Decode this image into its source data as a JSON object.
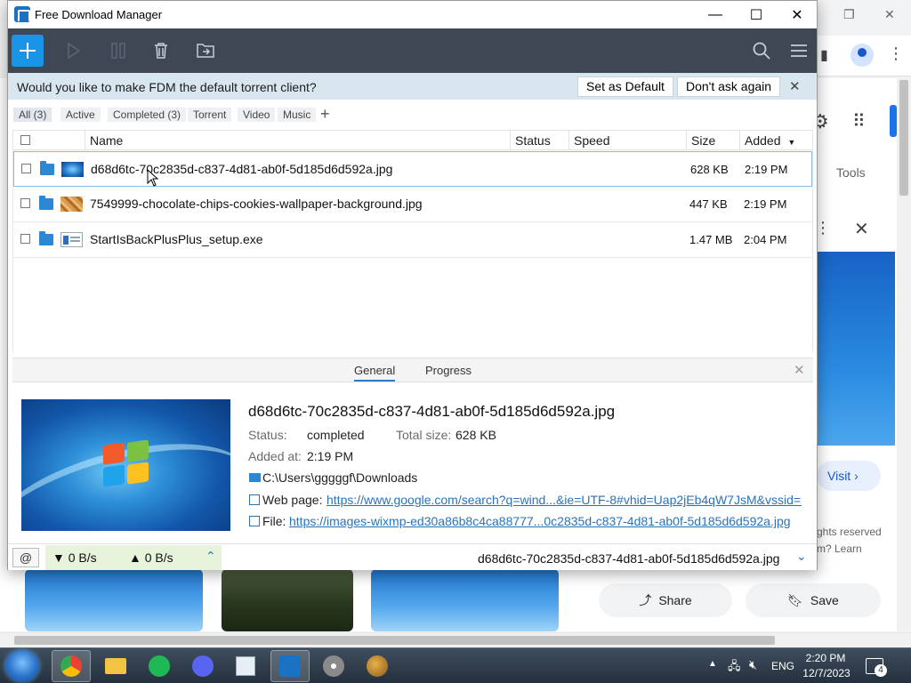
{
  "app": {
    "title": "Free Download Manager"
  },
  "window_controls": {
    "minimize": "—",
    "maximize": "☐",
    "close": "✕"
  },
  "notice": {
    "message": "Would you like to make FDM the default torrent client?",
    "set_default": "Set as Default",
    "dont_ask": "Don't ask again",
    "close": "✕"
  },
  "filters": [
    {
      "label": "All (3)"
    },
    {
      "label": "Active"
    },
    {
      "label": "Completed (3)"
    },
    {
      "label": "Torrent"
    },
    {
      "label": "Video"
    },
    {
      "label": "Music"
    }
  ],
  "filter_add": "+",
  "columns": {
    "name": "Name",
    "status": "Status",
    "speed": "Speed",
    "size": "Size",
    "added": "Added"
  },
  "downloads": [
    {
      "name": "d68d6tc-70c2835d-c837-4d81-ab0f-5d185d6d592a.jpg",
      "size": "628 KB",
      "added": "2:19 PM"
    },
    {
      "name": "7549999-chocolate-chips-cookies-wallpaper-background.jpg",
      "size": "447 KB",
      "added": "2:19 PM"
    },
    {
      "name": "StartIsBackPlusPlus_setup.exe",
      "size": "1.47 MB",
      "added": "2:04 PM"
    }
  ],
  "details": {
    "tabs": {
      "general": "General",
      "progress": "Progress"
    },
    "close": "✕",
    "file_name": "d68d6tc-70c2835d-c837-4d81-ab0f-5d185d6d592a.jpg",
    "status_label": "Status:",
    "status_value": "completed",
    "total_size_label": "Total size:",
    "total_size_value": "628 KB",
    "added_label": "Added at:",
    "added_value": "2:19 PM",
    "folder": "C:\\Users\\gggggf\\Downloads",
    "web_page_label": "Web page:",
    "web_page_url": "https://www.google.com/search?q=wind...&ie=UTF-8#vhid=Uap2jEb4qW7JsM&vssid=l",
    "file_label": "File:",
    "file_url": "https://images-wixmp-ed30a86b8c4ca88777...0c2835d-c837-4d81-ab0f-5d185d6d592a.jpg"
  },
  "statusbar": {
    "download_speed": "▼ 0 B/s",
    "upload_speed": "▲ 0 B/s",
    "current_file": "d68d6tc-70c2835d-c837-4d81-ab0f-5d185d6d592a.jpg"
  },
  "background_browser": {
    "tools_label": "Tools",
    "visit_label": "Visit",
    "rights_text": "ghts reserved",
    "learn_text": "m? Learn",
    "share_label": "Share",
    "save_label": "Save"
  },
  "taskbar": {
    "language": "ENG",
    "time": "2:20 PM",
    "date": "12/7/2023",
    "notification_count": "4"
  },
  "colors": {
    "toolbar_bg": "#3e4753",
    "accent": "#1a94e6",
    "notice_bg": "#d8e6ef",
    "speed_bg": "#e7f3da",
    "link": "#2a73b9"
  }
}
